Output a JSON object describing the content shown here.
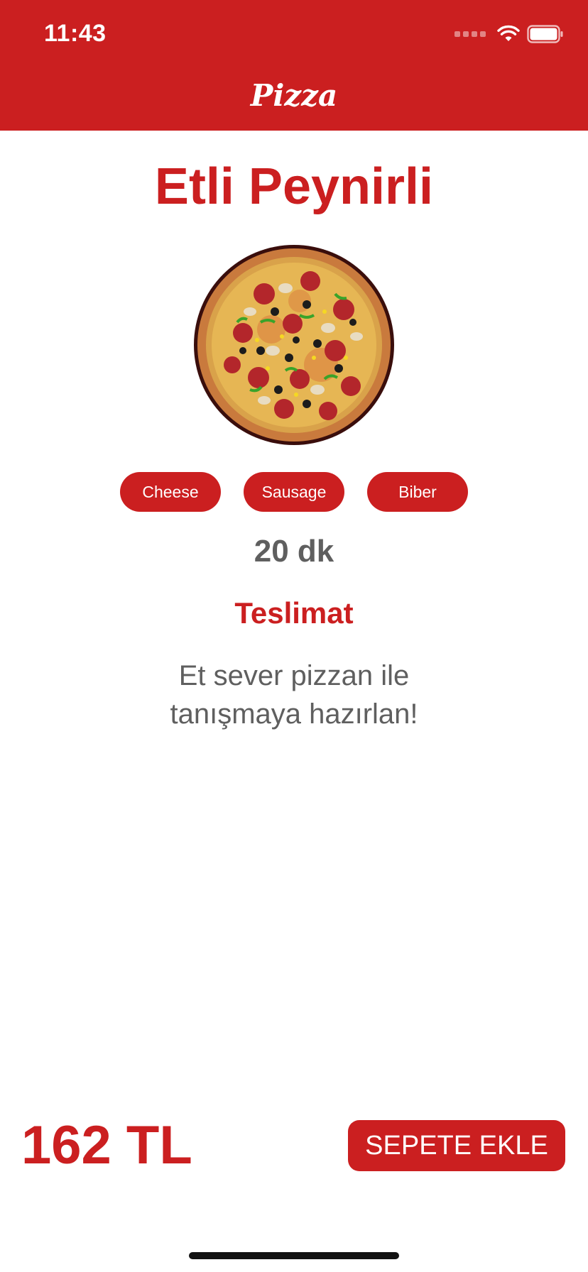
{
  "status_bar": {
    "time": "11:43"
  },
  "header": {
    "title": "Pizza"
  },
  "product": {
    "name": "Etli Peynirli",
    "tags": [
      "Cheese",
      "Sausage",
      "Biber"
    ],
    "duration": "20 dk",
    "delivery_label": "Teslimat",
    "description": "Et sever pizzan ile tanışmaya hazırlan!",
    "price": "162 TL"
  },
  "actions": {
    "add_to_cart_label": "SEPETE EKLE"
  },
  "colors": {
    "brand": "#cb1f20",
    "text_gray": "#5f5f5f"
  },
  "icons": [
    "signal-dots-icon",
    "wifi-icon",
    "battery-icon"
  ]
}
